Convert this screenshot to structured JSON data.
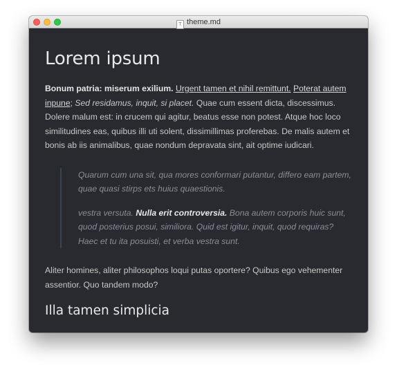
{
  "window": {
    "title": "theme.md",
    "file_icon_glyph": "T"
  },
  "document": {
    "heading1": "Lorem ipsum",
    "intro": {
      "bold": "Bonum patria: miserum exilium.",
      "link1": "Urgent tamen et nihil remittunt.",
      "link2": "Poterat autem inpune",
      "semicolon": ";",
      "italic": "Sed residamus, inquit, si placet.",
      "rest": "Quae cum essent dicta, discessimus. Dolere malum est: in crucem qui agitur, beatus esse non potest. Atque hoc loco similitudines eas, quibus illi uti solent, dissimillimas proferebas. De malis autem et bonis ab iis animalibus, quae nondum depravata sint, ait optime iudicari."
    },
    "blockquote": {
      "para1": "Quarum cum una sit, qua mores conformari putantur, differo eam partem, quae quasi stirps ets huius quaestionis.",
      "para2_start": "vestra versuta.",
      "para2_bold": "Nulla erit controversia.",
      "para2_rest": "Bona autem corporis huic sunt, quod posterius posui, similiora. Quid est igitur, inquit, quod requiras? Haec et tu ita posuisti, et verba vestra sunt."
    },
    "paragraph2": "Aliter homines, aliter philosophos loqui putas oportere? Quibus ego vehementer assentior. Quo tandem modo?",
    "heading2": "Illa tamen simplicia"
  },
  "colors": {
    "background": "#282a2f",
    "text": "#c8c8c8",
    "heading": "#e8e8e8",
    "quote_text": "#8b8e94",
    "quote_border": "#3b4451",
    "close": "#fc605c",
    "minimize": "#fdbc40",
    "maximize": "#34c84a"
  }
}
